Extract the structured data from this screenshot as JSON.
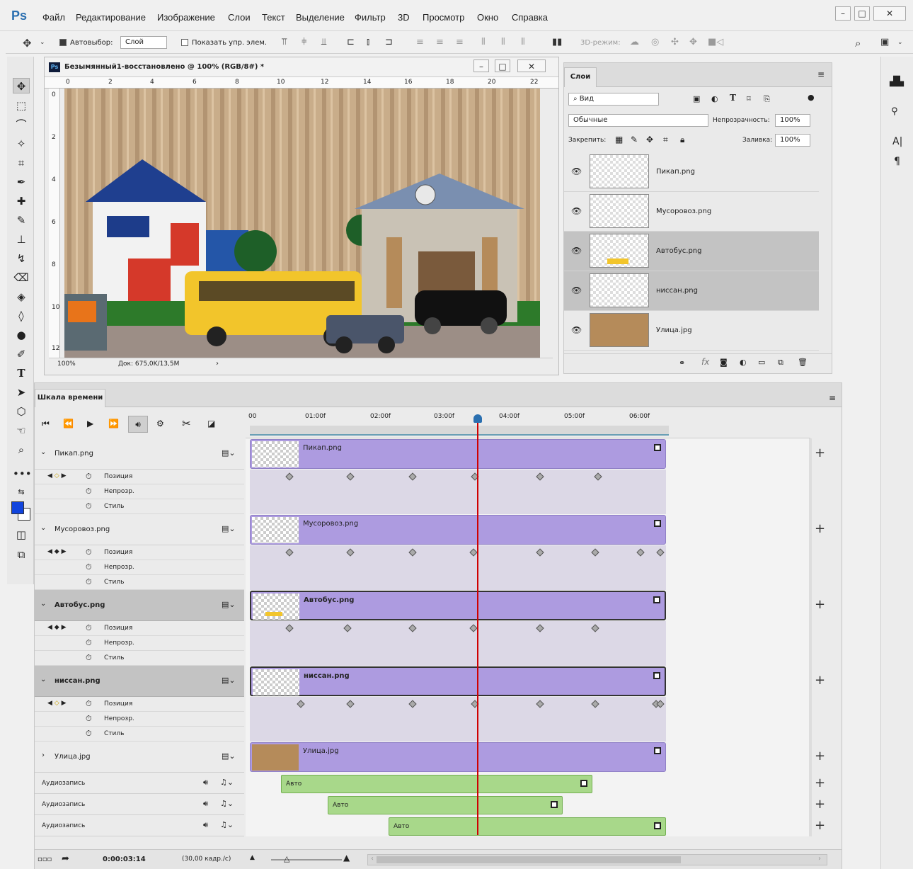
{
  "app": {
    "logo": "Ps"
  },
  "menu": [
    "Файл",
    "Редактирование",
    "Изображение",
    "Слои",
    "Текст",
    "Выделение",
    "Фильтр",
    "3D",
    "Просмотр",
    "Окно",
    "Справка"
  ],
  "options": {
    "autoselect_label": "Автовыбор:",
    "autoselect_value": "Слой",
    "show_transform": "Показать упр. элем.",
    "mode3d": "3D-режим:"
  },
  "document": {
    "title": "Безымянный1-восстановлено @ 100% (RGB/8#) *",
    "zoom": "100%",
    "doc_size": "Док: 675,0K/13,5M",
    "ruler_h": [
      "0",
      "2",
      "4",
      "6",
      "8",
      "10",
      "12",
      "14",
      "16",
      "18",
      "20",
      "22"
    ],
    "ruler_v": [
      "0",
      "2",
      "4",
      "6",
      "8",
      "10",
      "12"
    ]
  },
  "layers_panel": {
    "tab": "Слои",
    "filter": "Вид",
    "blend_mode": "Обычные",
    "opacity_label": "Непрозрачность:",
    "opacity": "100%",
    "lock_label": "Закрепить:",
    "fill_label": "Заливка:",
    "fill": "100%",
    "layers": [
      {
        "name": "Пикап.png",
        "highlight": false
      },
      {
        "name": "Мусоровоз.png",
        "highlight": false
      },
      {
        "name": "Автобус.png",
        "highlight": true
      },
      {
        "name": "ниссан.png",
        "highlight": true
      },
      {
        "name": "Улица.jpg",
        "highlight": false
      }
    ]
  },
  "timeline": {
    "tab": "Шкала времени",
    "ruler": [
      "00",
      "01:00f",
      "02:00f",
      "03:00f",
      "04:00f",
      "05:00f",
      "06:00f"
    ],
    "tracks": [
      {
        "name": "Пикап.png",
        "props": [
          "Позиция",
          "Непрозр.",
          "Стиль"
        ]
      },
      {
        "name": "Мусоровоз.png",
        "props": [
          "Позиция",
          "Непрозр.",
          "Стиль"
        ]
      },
      {
        "name": "Автобус.png",
        "props": [
          "Позиция",
          "Непрозр.",
          "Стиль"
        ]
      },
      {
        "name": "ниссан.png",
        "props": [
          "Позиция",
          "Непрозр.",
          "Стиль"
        ]
      },
      {
        "name": "Улица.jpg",
        "props": []
      }
    ],
    "audio": [
      {
        "label": "Аудиозапись",
        "clip": "Авто"
      },
      {
        "label": "Аудиозапись",
        "clip": "Авто"
      },
      {
        "label": "Аудиозапись",
        "clip": "Авто"
      }
    ],
    "timecode": "0:00:03:14",
    "fps": "(30,00 кадр./с)"
  },
  "colors": {
    "accent": "#2a6fb0",
    "clip": "#ad9be0",
    "audio": "#a8d88a",
    "playhead": "#d00000",
    "foreground": "#1144dd"
  }
}
